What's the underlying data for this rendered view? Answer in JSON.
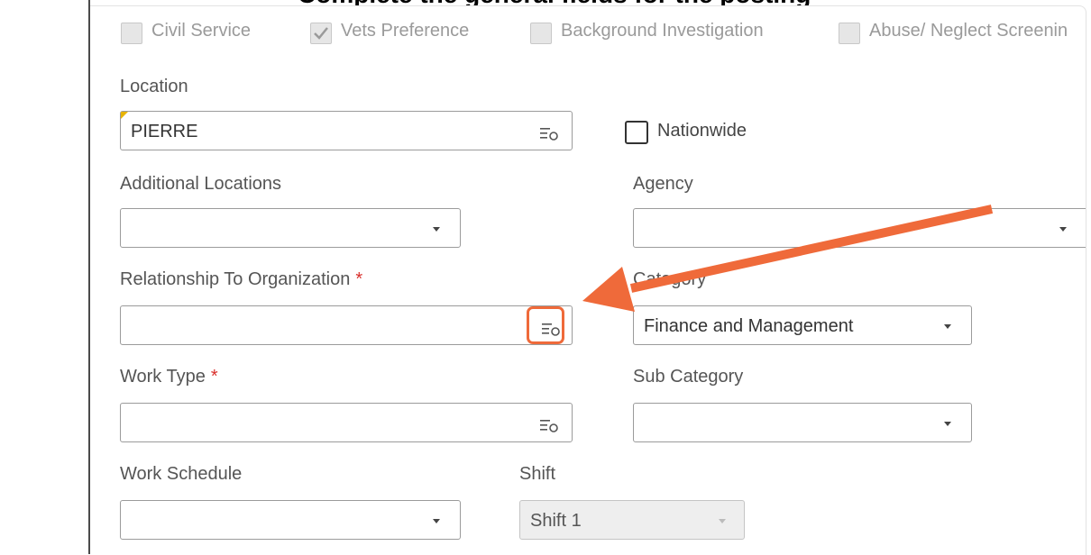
{
  "banner": {
    "text": "Complete the general fields for the posting"
  },
  "checkboxes": [
    {
      "label": "Civil Service",
      "checked": false
    },
    {
      "label": "Vets Preference",
      "checked": true
    },
    {
      "label": "Background Investigation",
      "checked": false
    },
    {
      "label": "Abuse/ Neglect Screenin",
      "checked": false
    }
  ],
  "fields": {
    "location": {
      "label": "Location",
      "value": "PIERRE"
    },
    "nationwide": {
      "label": "Nationwide",
      "checked": false
    },
    "additional_locations": {
      "label": "Additional Locations",
      "value": ""
    },
    "agency": {
      "label": "Agency",
      "value": ""
    },
    "relationship": {
      "label": "Relationship To Organization",
      "required": "*",
      "value": ""
    },
    "category": {
      "label": "Category",
      "value": "Finance and Management"
    },
    "work_type": {
      "label": "Work Type",
      "required": "*",
      "value": ""
    },
    "sub_category": {
      "label": "Sub Category",
      "value": ""
    },
    "work_schedule": {
      "label": "Work Schedule",
      "value": ""
    },
    "shift": {
      "label": "Shift",
      "value": "Shift 1"
    }
  },
  "colors": {
    "annotation": "#ef6a3a",
    "required": "#d9302c",
    "border": "#9b9b9b"
  },
  "icons": {
    "lookup": "list-search-icon",
    "dropdown": "caret-down-icon",
    "check": "checkmark-icon"
  }
}
